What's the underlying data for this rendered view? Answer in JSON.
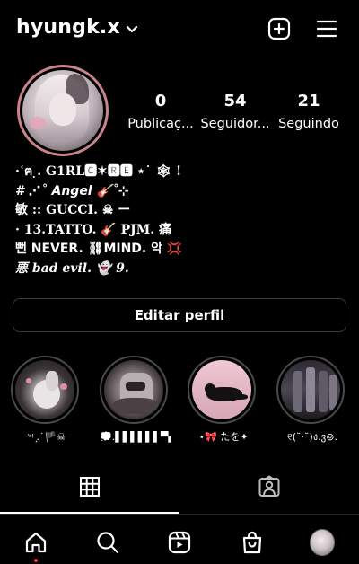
{
  "header": {
    "username": "hyungk.x"
  },
  "stats": {
    "posts": {
      "count": "0",
      "label": "Publicaç..."
    },
    "followers": {
      "count": "54",
      "label": "Seguidor..."
    },
    "following": {
      "count": "21",
      "label": "Seguindo"
    }
  },
  "bio": {
    "lines": [
      "·ʿฅ ̣. G1RL🅲✶🆁🅴 ⋆˙ 🕸 !",
      "#  ⋰˚ Angel 🎸˚⊹",
      "敏 :: GUCCI. ☠ ー",
      "· 13.TATTO. 🎸 PJM. 痛",
      "뻔 NEVER. ⛓MIND. 악 💢",
      "悪 bad evil. 👻 9."
    ]
  },
  "edit_button_label": "Editar perfil",
  "highlights": [
    {
      "label": "ᵛᵎ ͙.˙🏴☠"
    },
    {
      "label": "💭.▌▌▌▌▌▌▀▄█"
    },
    {
      "label": "⋆🎀 たを✦"
    },
    {
      "label": "୧(˘·˘)ง.ვ⊚."
    }
  ],
  "icons": {
    "header": [
      "chevron-down-icon",
      "new-post-icon",
      "menu-icon"
    ],
    "tabs": [
      "grid-icon",
      "tagged-icon"
    ],
    "nav": [
      "home-icon",
      "search-icon",
      "reels-icon",
      "shop-icon",
      "profile-avatar"
    ]
  },
  "colors": {
    "background": "#000000",
    "text": "#ffffff",
    "avatar_ring": "#c9838c",
    "notification_dot": "#ff3040",
    "button_border": "#3a3a3a"
  }
}
